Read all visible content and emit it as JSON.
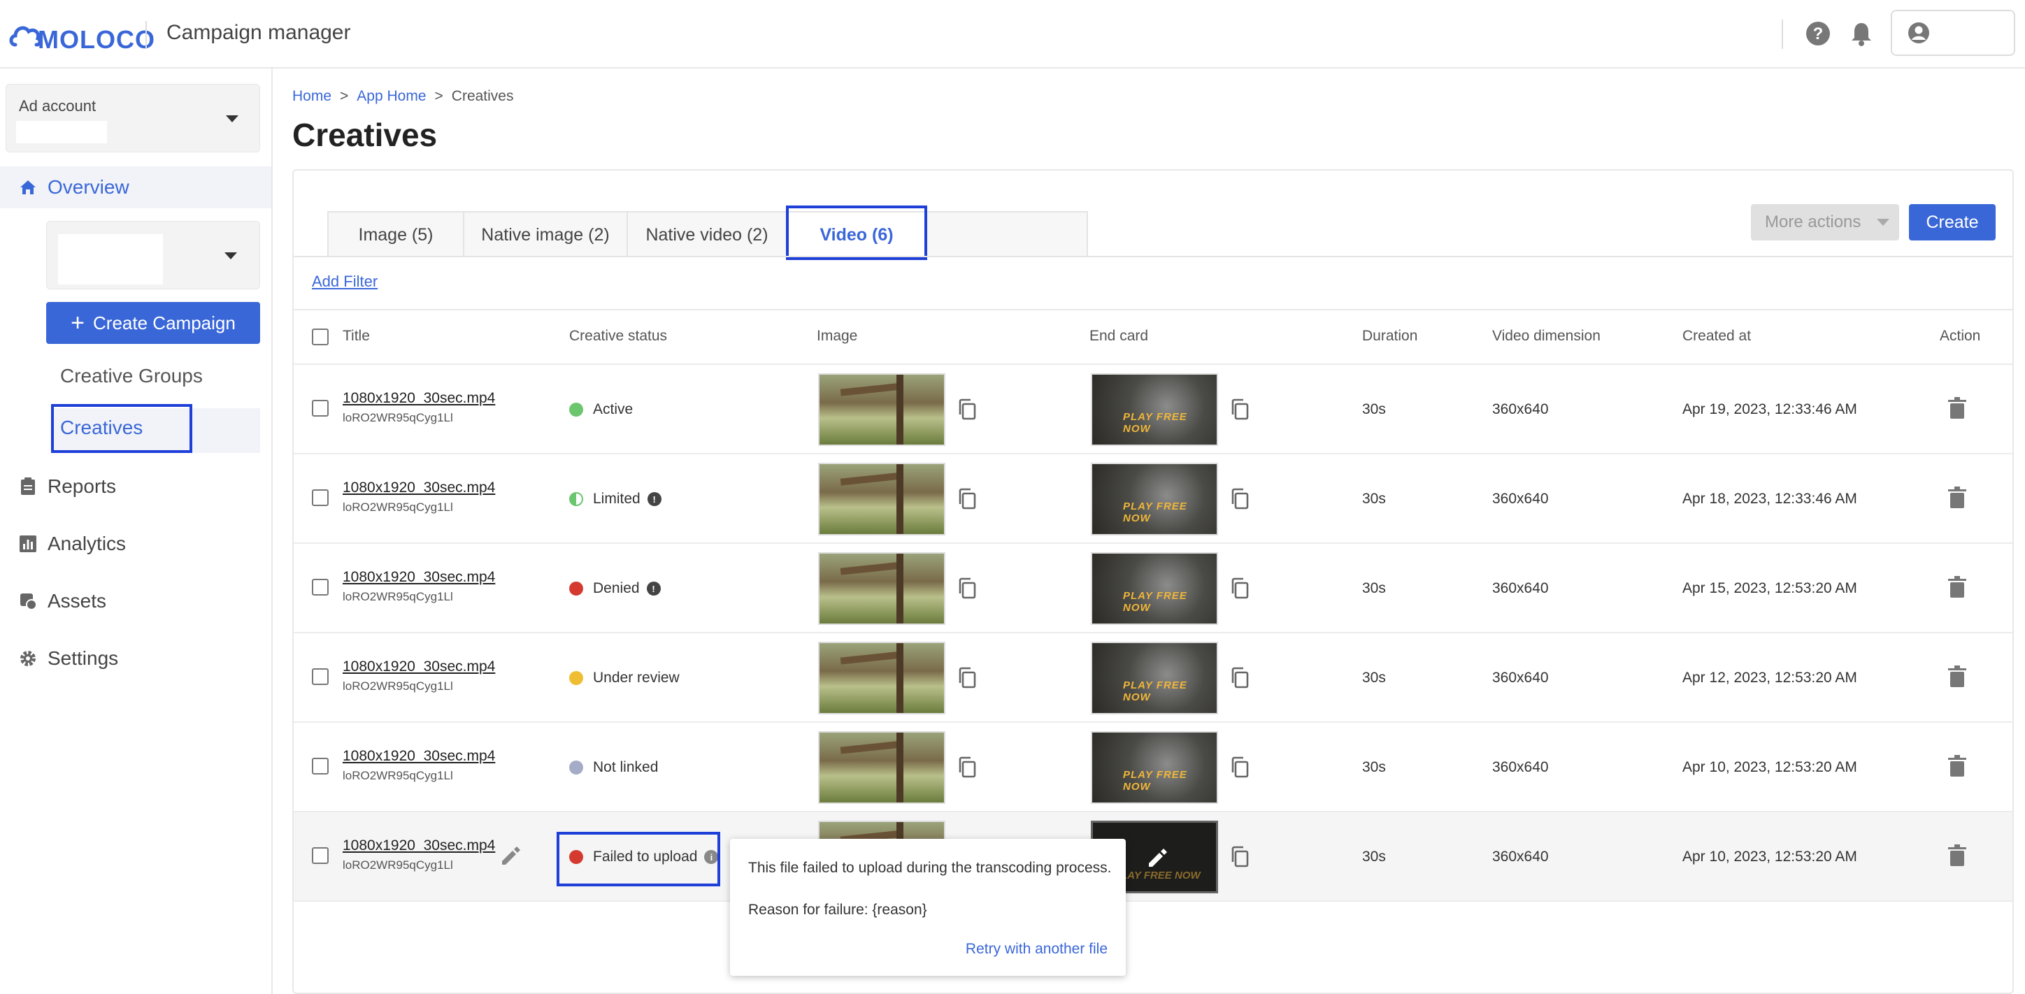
{
  "header": {
    "logo_text": "MOLOCO",
    "app_title": "Campaign manager"
  },
  "sidebar": {
    "ad_account_label": "Ad account",
    "nav": {
      "overview": "Overview",
      "create_campaign": "Create Campaign",
      "creative_groups": "Creative Groups",
      "creatives": "Creatives",
      "reports": "Reports",
      "analytics": "Analytics",
      "assets": "Assets",
      "settings": "Settings"
    }
  },
  "breadcrumb": {
    "home": "Home",
    "app_home": "App Home",
    "current": "Creatives",
    "separator": ">"
  },
  "page_title": "Creatives",
  "tabs": [
    {
      "label": "Image (5)"
    },
    {
      "label": "Native image (2)"
    },
    {
      "label": "Native video (2)"
    },
    {
      "label": "Video (6)"
    }
  ],
  "toolbar": {
    "more_actions": "More actions",
    "create": "Create",
    "add_filter": "Add Filter"
  },
  "table": {
    "columns": {
      "title": "Title",
      "status": "Creative status",
      "image": "Image",
      "end_card": "End card",
      "duration": "Duration",
      "dimension": "Video dimension",
      "created": "Created at",
      "action": "Action"
    },
    "end_card_text": "PLAY FREE NOW",
    "rows": [
      {
        "title": "1080x1920_30sec.mp4",
        "id": "loRO2WR95qCyg1Ll",
        "status": "Active",
        "status_color": "#6cc66e",
        "duration": "30s",
        "dimension": "360x640",
        "created": "Apr 19, 2023, 12:33:46 AM"
      },
      {
        "title": "1080x1920_30sec.mp4",
        "id": "loRO2WR95qCyg1Ll",
        "status": "Limited",
        "status_color": "#6cc66e",
        "duration": "30s",
        "dimension": "360x640",
        "created": "Apr 18, 2023, 12:33:46 AM"
      },
      {
        "title": "1080x1920_30sec.mp4",
        "id": "loRO2WR95qCyg1Ll",
        "status": "Denied",
        "status_color": "#d43a30",
        "duration": "30s",
        "dimension": "360x640",
        "created": "Apr 15, 2023, 12:53:20 AM"
      },
      {
        "title": "1080x1920_30sec.mp4",
        "id": "loRO2WR95qCyg1Ll",
        "status": "Under review",
        "status_color": "#efbd32",
        "duration": "30s",
        "dimension": "360x640",
        "created": "Apr 12, 2023, 12:53:20 AM"
      },
      {
        "title": "1080x1920_30sec.mp4",
        "id": "loRO2WR95qCyg1Ll",
        "status": "Not linked",
        "status_color": "#a5acc7",
        "duration": "30s",
        "dimension": "360x640",
        "created": "Apr 10, 2023, 12:53:20 AM"
      },
      {
        "title": "1080x1920_30sec.mp4",
        "id": "loRO2WR95qCyg1Ll",
        "status": "Failed to upload",
        "status_color": "#d43a30",
        "duration": "30s",
        "dimension": "360x640",
        "created": "Apr 10, 2023, 12:53:20 AM"
      }
    ]
  },
  "tooltip": {
    "line1": "This file failed to upload during the transcoding process.",
    "line2": "Reason for failure: {reason}",
    "action": "Retry with another file"
  },
  "colors": {
    "accent": "#3a67d8",
    "highlight_outline": "#1e3fd8"
  }
}
